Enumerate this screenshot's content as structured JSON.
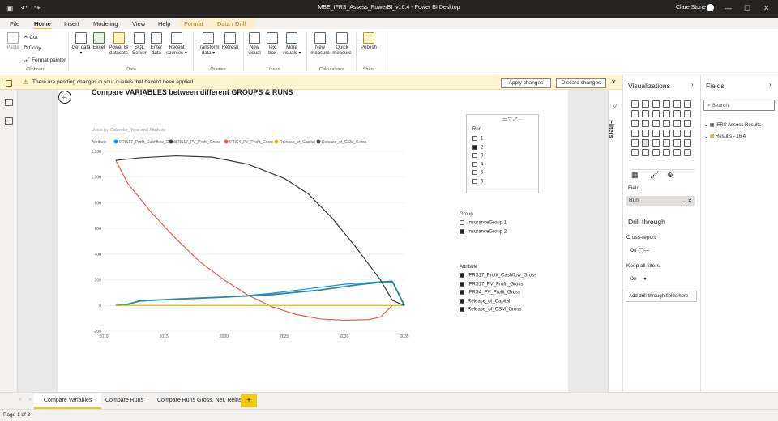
{
  "window": {
    "title": "MBE_IFRS_Assess_PowerBI_v16.4 - Power BI Desktop",
    "user": "Clare Stone"
  },
  "menu": {
    "tabs": [
      "File",
      "Home",
      "Insert",
      "Modeling",
      "View",
      "Help",
      "Format",
      "Data / Drill"
    ],
    "active": "Home"
  },
  "ribbon": {
    "clipboard": {
      "paste": "Paste",
      "cut": "Cut",
      "copy": "Copy",
      "format_painter": "Format painter",
      "group": "Clipboard"
    },
    "data": {
      "get_data": "Get data",
      "excel": "Excel",
      "pbi_datasets": "Power BI datasets",
      "sql": "SQL Server",
      "enter": "Enter data",
      "recent": "Recent sources",
      "group": "Data"
    },
    "queries": {
      "transform": "Transform data",
      "refresh": "Refresh",
      "group": "Queries"
    },
    "insert": {
      "new_visual": "New visual",
      "text_box": "Text box",
      "more_visuals": "More visuals",
      "group": "Insert"
    },
    "calculations": {
      "new_measure": "New measure",
      "quick_measure": "Quick measure",
      "group": "Calculations"
    },
    "share": {
      "publish": "Publish",
      "group": "Share"
    }
  },
  "warning": {
    "text": "There are pending changes in your queries that haven't been applied.",
    "apply": "Apply changes",
    "discard": "Discard changes"
  },
  "report": {
    "title": "Compare VARIABLES between different GROUPS & RUNS",
    "subtitle": "Value by Calendar_Year and Attribute",
    "legend_title": "Attribute"
  },
  "chart_data": {
    "type": "line",
    "subtitle": "Value by Calendar_Year and Attribute",
    "legend_title": "Attribute",
    "x": [
      2011,
      2012,
      2013,
      2014,
      2015,
      2016,
      2017,
      2018,
      2019,
      2020,
      2021,
      2022,
      2023,
      2024,
      2025
    ],
    "xticks": [
      "2010",
      "2015",
      "2020",
      "2025",
      "2030",
      "2035"
    ],
    "yticks": [
      "1,200",
      "1,000",
      "800",
      "600",
      "400",
      "200",
      "0",
      "-200"
    ],
    "ylim": [
      -200,
      1200
    ],
    "xlim": [
      2010,
      2035
    ],
    "series": [
      {
        "name": "IFRS17_Profit_Cashflow_Gross",
        "color": "#118dff",
        "points": [
          [
            2011,
            0
          ],
          [
            2012,
            5
          ],
          [
            2013,
            40
          ],
          [
            2015,
            45
          ],
          [
            2018,
            55
          ],
          [
            2021,
            70
          ],
          [
            2024,
            95
          ],
          [
            2027,
            130
          ],
          [
            2030,
            165
          ],
          [
            2033,
            185
          ],
          [
            2034,
            190
          ],
          [
            2035,
            0
          ]
        ]
      },
      {
        "name": "IFRS17_PV_Profit_Gross",
        "color": "#3a4a54",
        "points": [
          [
            2011,
            0
          ],
          [
            2012,
            10
          ],
          [
            2013,
            35
          ],
          [
            2016,
            50
          ],
          [
            2020,
            65
          ],
          [
            2024,
            85
          ],
          [
            2028,
            120
          ],
          [
            2031,
            160
          ],
          [
            2033,
            180
          ],
          [
            2034,
            185
          ],
          [
            2035,
            0
          ]
        ]
      },
      {
        "name": "IFRS4_PV_Profit_Gross",
        "color": "#e8604a",
        "points": [
          [
            2011,
            1130
          ],
          [
            2012,
            950
          ],
          [
            2014,
            720
          ],
          [
            2016,
            520
          ],
          [
            2018,
            340
          ],
          [
            2020,
            200
          ],
          [
            2022,
            80
          ],
          [
            2024,
            -10
          ],
          [
            2026,
            -70
          ],
          [
            2028,
            -105
          ],
          [
            2030,
            -115
          ],
          [
            2032,
            -110
          ],
          [
            2033,
            -90
          ],
          [
            2034,
            0
          ]
        ]
      },
      {
        "name": "Release_of_Capital",
        "color": "#e6b800",
        "points": [
          [
            2011,
            0
          ],
          [
            2034,
            0
          ],
          [
            2035,
            0
          ]
        ]
      },
      {
        "name": "Release_of_CSM_Gross",
        "color": "#3a4a54",
        "points": [
          [
            2011,
            1130
          ],
          [
            2013,
            1150
          ],
          [
            2016,
            1165
          ],
          [
            2019,
            1155
          ],
          [
            2022,
            1100
          ],
          [
            2025,
            990
          ],
          [
            2027,
            870
          ],
          [
            2029,
            680
          ],
          [
            2031,
            450
          ],
          [
            2033,
            200
          ],
          [
            2034,
            40
          ],
          [
            2035,
            0
          ]
        ]
      }
    ]
  },
  "slicers": {
    "run": {
      "title": "Run",
      "items": [
        {
          "label": "1",
          "checked": false
        },
        {
          "label": "2",
          "checked": true
        },
        {
          "label": "3",
          "checked": false
        },
        {
          "label": "4",
          "checked": false
        },
        {
          "label": "5",
          "checked": false
        },
        {
          "label": "6",
          "checked": false
        }
      ]
    },
    "group": {
      "title": "Group",
      "items": [
        {
          "label": "InsuranceGroup 1",
          "checked": false
        },
        {
          "label": "InsuranceGroup 2",
          "checked": true
        }
      ]
    },
    "attribute": {
      "title": "Attribute",
      "items": [
        {
          "label": "IFRS17_Profit_Cashflow_Gross",
          "checked": true
        },
        {
          "label": "IFRS17_PV_Profit_Gross",
          "checked": true
        },
        {
          "label": "IFRS4_PV_Profit_Gross",
          "checked": true
        },
        {
          "label": "Release_of_Capital",
          "checked": true
        },
        {
          "label": "Release_of_CSM_Gross",
          "checked": true
        }
      ]
    }
  },
  "filters_label": "Filters",
  "visualizations": {
    "title": "Visualizations",
    "field_label": "Field",
    "field_value": "Run",
    "drill_title": "Drill through",
    "cross_report": "Cross-report",
    "cross_state": "Off",
    "keep_filters": "Keep all filters",
    "keep_state": "On",
    "add_drill": "Add drill-through fields here"
  },
  "fields": {
    "title": "Fields",
    "search_placeholder": "Search",
    "items": [
      "IFRS Assess Results",
      "Results - 16 4"
    ]
  },
  "pages": {
    "tabs": [
      "Compare Variables",
      "Compare Runs",
      "Compare Runs Gross, Net, Reins"
    ],
    "active": 0,
    "add": "+"
  },
  "status": {
    "page": "Page 1 of 3"
  }
}
